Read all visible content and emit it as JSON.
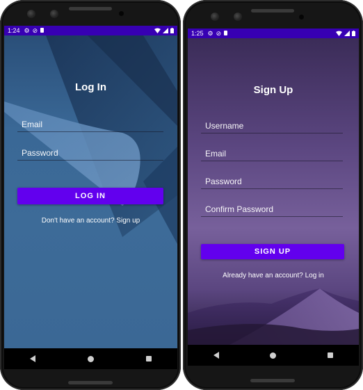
{
  "login": {
    "status": {
      "time": "1:24"
    },
    "title": "Log In",
    "fields": [
      {
        "placeholder": "Email"
      },
      {
        "placeholder": "Password"
      }
    ],
    "button_label": "LOG IN",
    "alt_link": "Don't have an account? Sign up"
  },
  "signup": {
    "status": {
      "time": "1:25"
    },
    "title": "Sign Up",
    "fields": [
      {
        "placeholder": "Username"
      },
      {
        "placeholder": "Email"
      },
      {
        "placeholder": "Password"
      },
      {
        "placeholder": "Confirm Password"
      }
    ],
    "button_label": "SIGN UP",
    "alt_link": "Already have an account? Log in"
  },
  "status_icons": [
    "settings-icon",
    "sync-icon",
    "sd-card-icon",
    "wifi-icon",
    "signal-icon",
    "battery-icon"
  ],
  "nav_icons": [
    "back-icon",
    "home-icon",
    "recent-apps-icon"
  ],
  "colors": {
    "status_bar": "#3700b3",
    "button": "#6200ee",
    "login_background": "#3d6b98",
    "signup_background": "#5b4680"
  }
}
